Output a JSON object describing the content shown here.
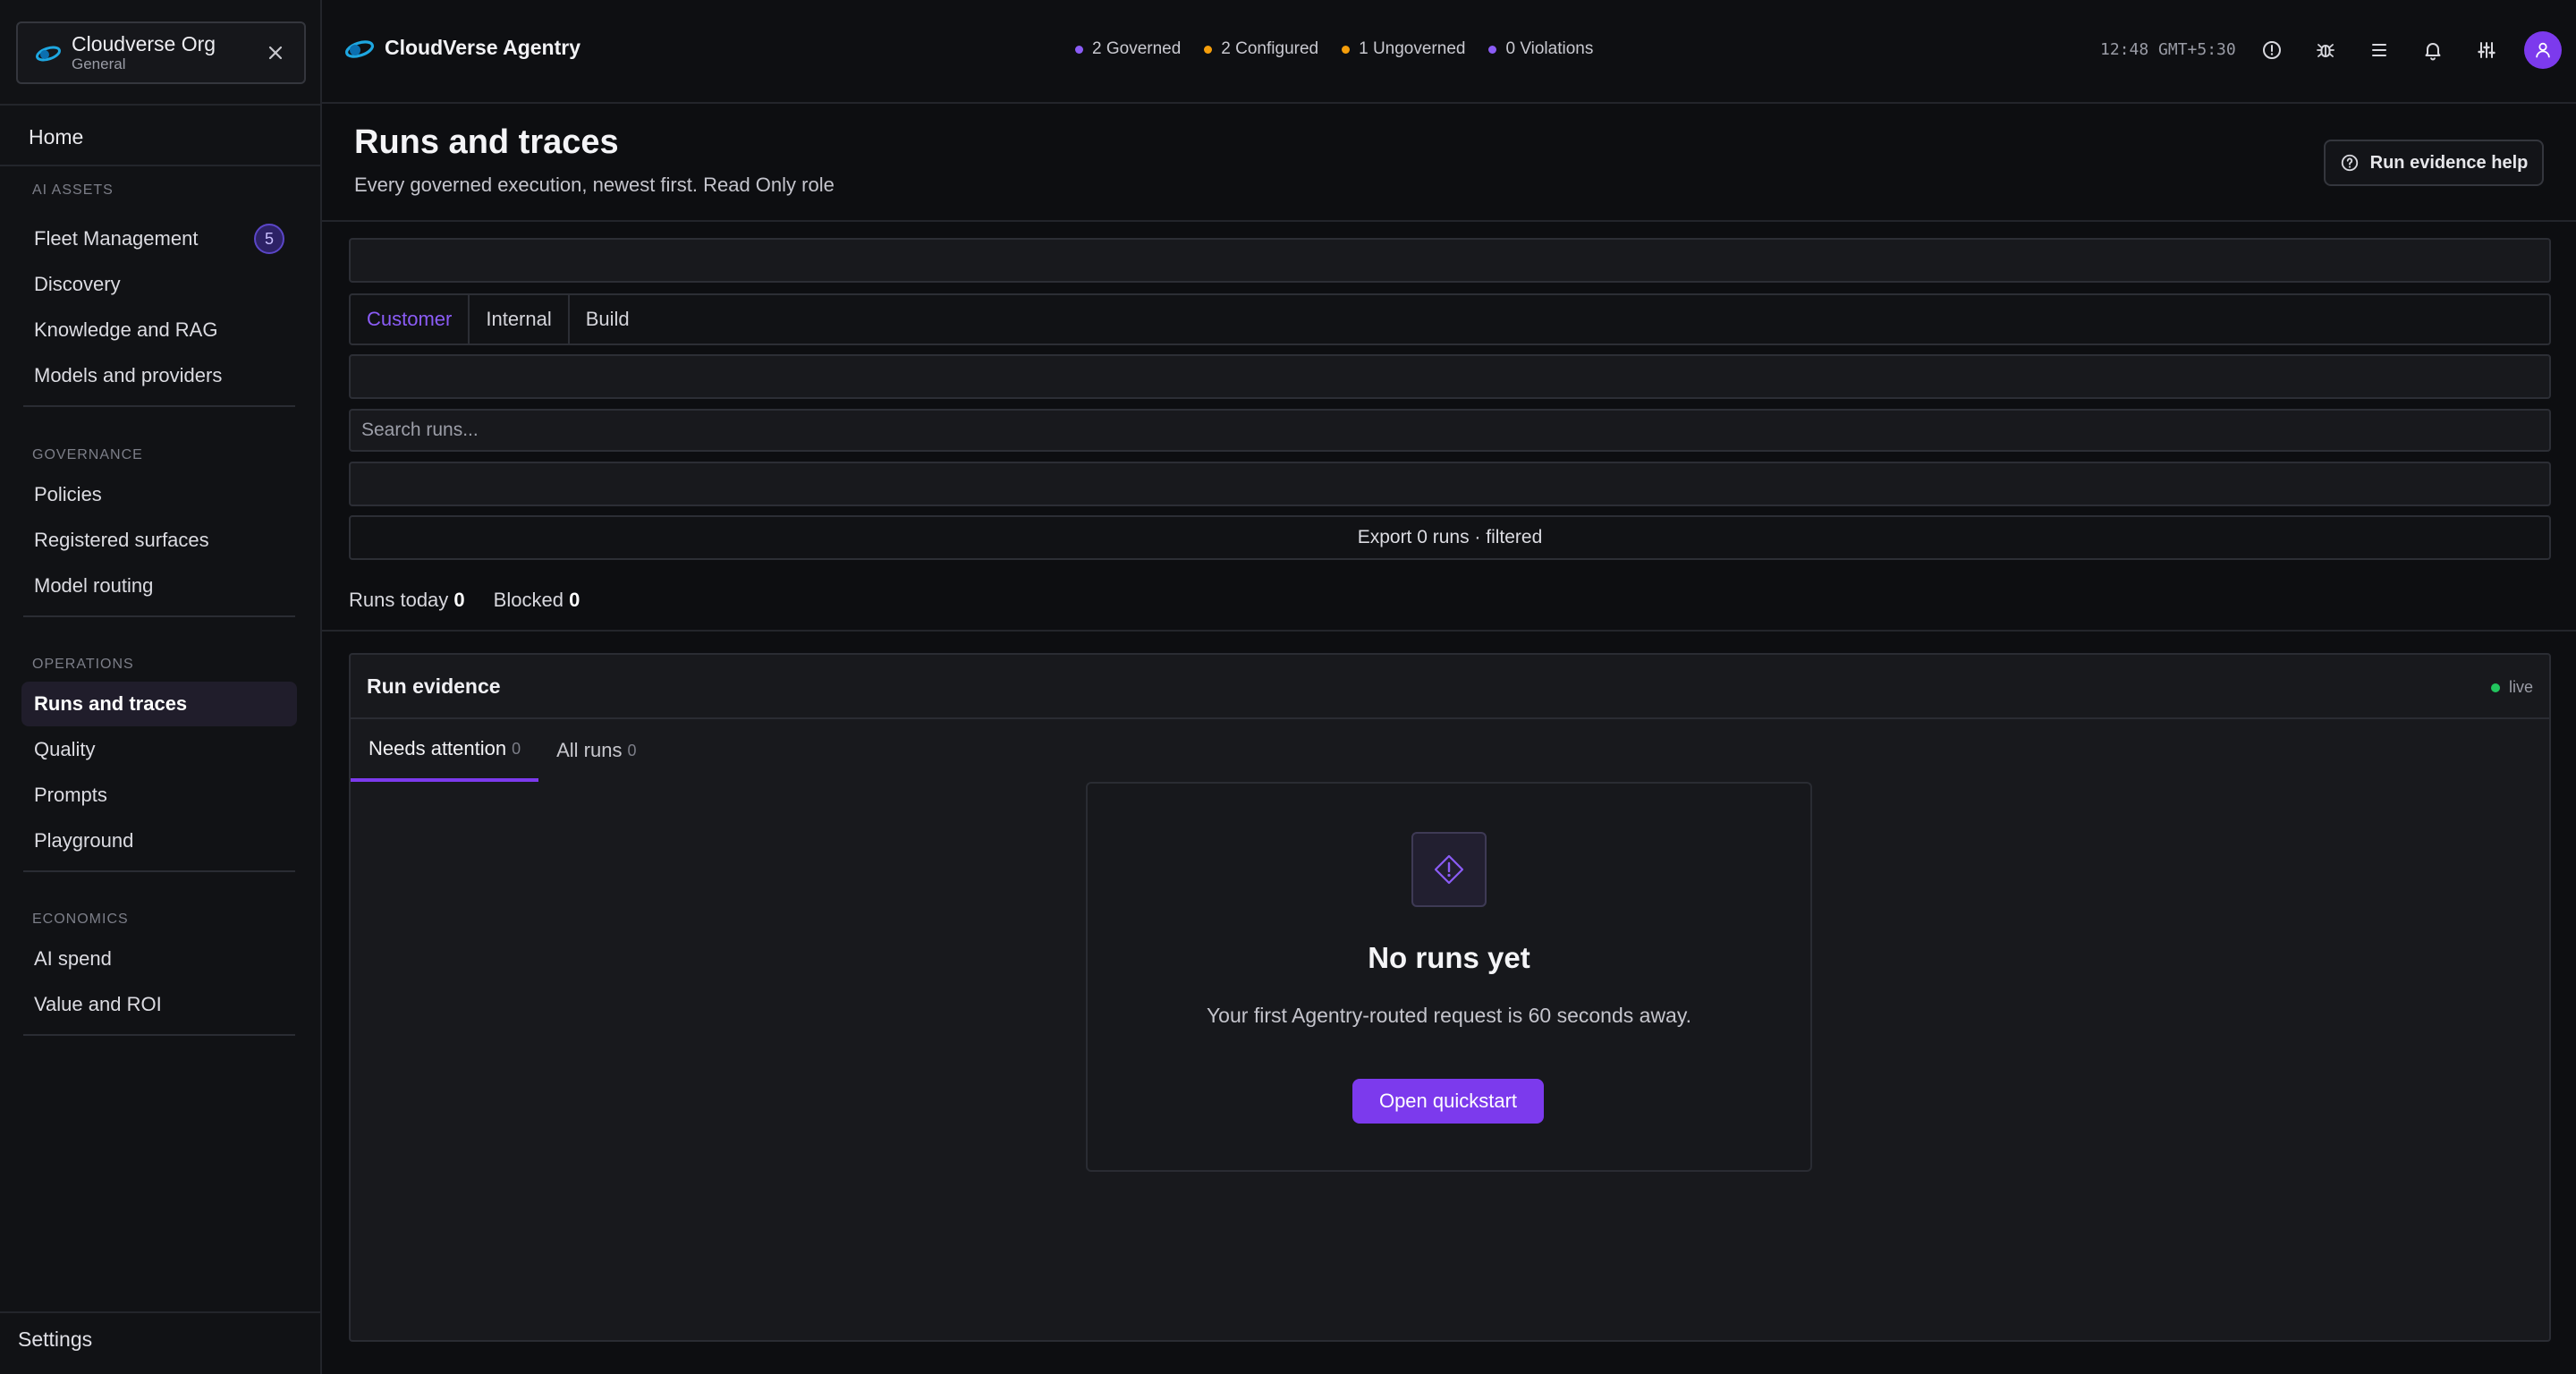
{
  "org": {
    "name": "Cloudverse Org",
    "workspace": "General"
  },
  "sidebar": {
    "home": "Home",
    "sections": [
      {
        "title": "AI ASSETS",
        "items": [
          {
            "label": "Fleet Management",
            "badge": "5"
          },
          {
            "label": "Discovery"
          },
          {
            "label": "Knowledge and RAG"
          },
          {
            "label": "Models and providers"
          }
        ]
      },
      {
        "title": "GOVERNANCE",
        "items": [
          {
            "label": "Policies"
          },
          {
            "label": "Registered surfaces"
          },
          {
            "label": "Model routing"
          }
        ]
      },
      {
        "title": "OPERATIONS",
        "items": [
          {
            "label": "Runs and traces",
            "active": true
          },
          {
            "label": "Quality"
          },
          {
            "label": "Prompts"
          },
          {
            "label": "Playground"
          }
        ]
      },
      {
        "title": "ECONOMICS",
        "items": [
          {
            "label": "AI spend"
          },
          {
            "label": "Value and ROI"
          }
        ]
      }
    ],
    "settings": "Settings"
  },
  "header": {
    "brand": "CloudVerse Agentry",
    "status": [
      {
        "label": "2 Governed",
        "color": "#8b5cf6"
      },
      {
        "label": "2 Configured",
        "color": "#f59e0b"
      },
      {
        "label": "1 Ungoverned",
        "color": "#f59e0b"
      },
      {
        "label": "0 Violations",
        "color": "#8b5cf6"
      }
    ],
    "clock": "12:48 GMT+5:30",
    "icons": [
      "alert-circle-icon",
      "bug-icon",
      "list-icon",
      "bell-icon",
      "sliders-icon"
    ]
  },
  "page": {
    "title": "Runs and traces",
    "subtitle": "Every governed execution, newest first. Read Only role",
    "help_button": "Run evidence help"
  },
  "filters": {
    "scope_tabs": [
      "Customer",
      "Internal",
      "Build"
    ],
    "selected_scope": "Customer",
    "search_placeholder": "Search runs...",
    "export_label": "Export 0 runs · filtered"
  },
  "kpis": {
    "runs_today_label": "Runs today",
    "runs_today_value": "0",
    "blocked_label": "Blocked",
    "blocked_value": "0"
  },
  "evidence": {
    "title": "Run evidence",
    "live_label": "live",
    "tabs": [
      {
        "label": "Needs attention",
        "count": "0",
        "selected": true
      },
      {
        "label": "All runs",
        "count": "0"
      }
    ],
    "empty": {
      "title": "No runs yet",
      "subtitle": "Your first Agentry-routed request is 60 seconds away.",
      "button": "Open quickstart"
    }
  },
  "colors": {
    "accent": "#7c3aed",
    "live": "#22c55e",
    "background": "#0d0e11"
  }
}
